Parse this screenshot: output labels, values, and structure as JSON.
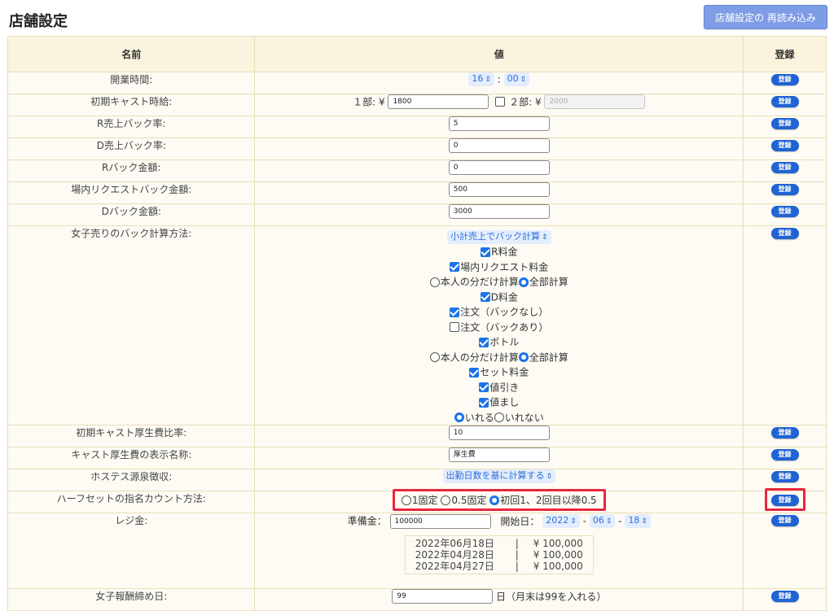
{
  "page": {
    "title": "店舗設定",
    "reload_label": "店舗設定の 再読み込み"
  },
  "table": {
    "headers": {
      "name": "名前",
      "value": "値",
      "action": "登録"
    },
    "register_label": "登録"
  },
  "rows": {
    "open_time": {
      "name": "開業時間:",
      "hour": "16",
      "colon": ":",
      "minute": "00"
    },
    "hourly": {
      "name": "初期キャスト時給:",
      "part1_label": "１部: ¥",
      "part1_value": "1800",
      "part2_label": "２部: ¥",
      "part2_value": "2000",
      "part2_checked": false
    },
    "r_back_rate": {
      "name": "R売上バック率:",
      "value": "5"
    },
    "d_back_rate": {
      "name": "D売上バック率:",
      "value": "0"
    },
    "r_back_amount": {
      "name": "Rバック金額:",
      "value": "0"
    },
    "request_back": {
      "name": "場内リクエストバック金額:",
      "value": "500"
    },
    "d_back_amount": {
      "name": "Dバック金額:",
      "value": "3000"
    },
    "girl_back": {
      "name": "女子売りのバック計算方法:",
      "method": "小計売上でバック計算",
      "r_fee": "R料金",
      "request_fee": "場内リクエスト料金",
      "radio_self": "本人の分だけ計算",
      "radio_all": "全部計算",
      "d_fee": "D料金",
      "order_noback": "注文（バックなし）",
      "order_back": "注文（バックあり）",
      "bottle": "ボトル",
      "radio_self2": "本人の分だけ計算",
      "radio_all2": "全部計算",
      "set_fee": "セット料金",
      "discount": "値引き",
      "surcharge": "値まし",
      "include": "いれる",
      "exclude": "いれない"
    },
    "welfare_rate": {
      "name": "初期キャスト厚生費比率:",
      "value": "10"
    },
    "welfare_name": {
      "name": "キャスト厚生費の表示名称:",
      "value": "厚生費"
    },
    "withholding": {
      "name": "ホステス源泉徴収:",
      "method": "出勤日数を基に計算する"
    },
    "half_set": {
      "name": "ハーフセットの指名カウント方法:",
      "opt1": "1固定",
      "opt2": "0.5固定",
      "opt3": "初回1、2回目以降0.5"
    },
    "register": {
      "name": "レジ金:",
      "reserve_label": "準備金：",
      "reserve_value": "100000",
      "start_label": "開始日：",
      "year": "2022",
      "month": "06",
      "day": "18",
      "dash": "-",
      "history": [
        {
          "date": "2022年06月18日",
          "sep": "|",
          "amount": "¥ 100,000"
        },
        {
          "date": "2022年04月28日",
          "sep": "|",
          "amount": "¥ 100,000"
        },
        {
          "date": "2022年04月27日",
          "sep": "|",
          "amount": "¥ 100,000"
        }
      ]
    },
    "closing": {
      "name": "女子報酬締め日:",
      "value": "99",
      "suffix": "日（月末は99を入れる）"
    }
  },
  "colors": {
    "accent": "#1b73e8",
    "highlight": "#e8283f",
    "reload_bg": "#7f9ce6",
    "table_bg": "#fdfbf3",
    "header_bg": "#faf3dd"
  }
}
